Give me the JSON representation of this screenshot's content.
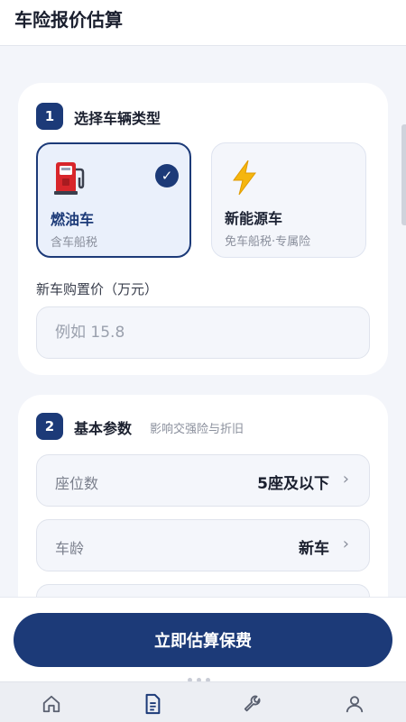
{
  "header": {
    "title": "车险报价估算"
  },
  "step1": {
    "number": "1",
    "title": "选择车辆类型",
    "options": [
      {
        "name": "燃油车",
        "desc": "含车船税",
        "icon": "gas-pump-icon",
        "selected": true
      },
      {
        "name": "新能源车",
        "desc": "免车船税·专属险",
        "icon": "lightning-icon",
        "selected": false
      }
    ],
    "price_label": "新车购置价（万元）",
    "price_placeholder": "例如 15.8",
    "price_value": ""
  },
  "step2": {
    "number": "2",
    "title": "基本参数",
    "subtitle": "影响交强险与折旧",
    "rows": [
      {
        "label": "座位数",
        "value": "5座及以下"
      },
      {
        "label": "车龄",
        "value": "新车"
      }
    ]
  },
  "cta": {
    "label": "立即估算保费"
  },
  "tabbar": {
    "items": [
      {
        "icon": "home-icon",
        "active": false
      },
      {
        "icon": "document-icon",
        "active": true
      },
      {
        "icon": "wrench-icon",
        "active": false
      },
      {
        "icon": "user-icon",
        "active": false
      }
    ]
  },
  "colors": {
    "primary": "#1c3a78",
    "background": "#f3f5fa",
    "muted": "#8a8f9c"
  }
}
